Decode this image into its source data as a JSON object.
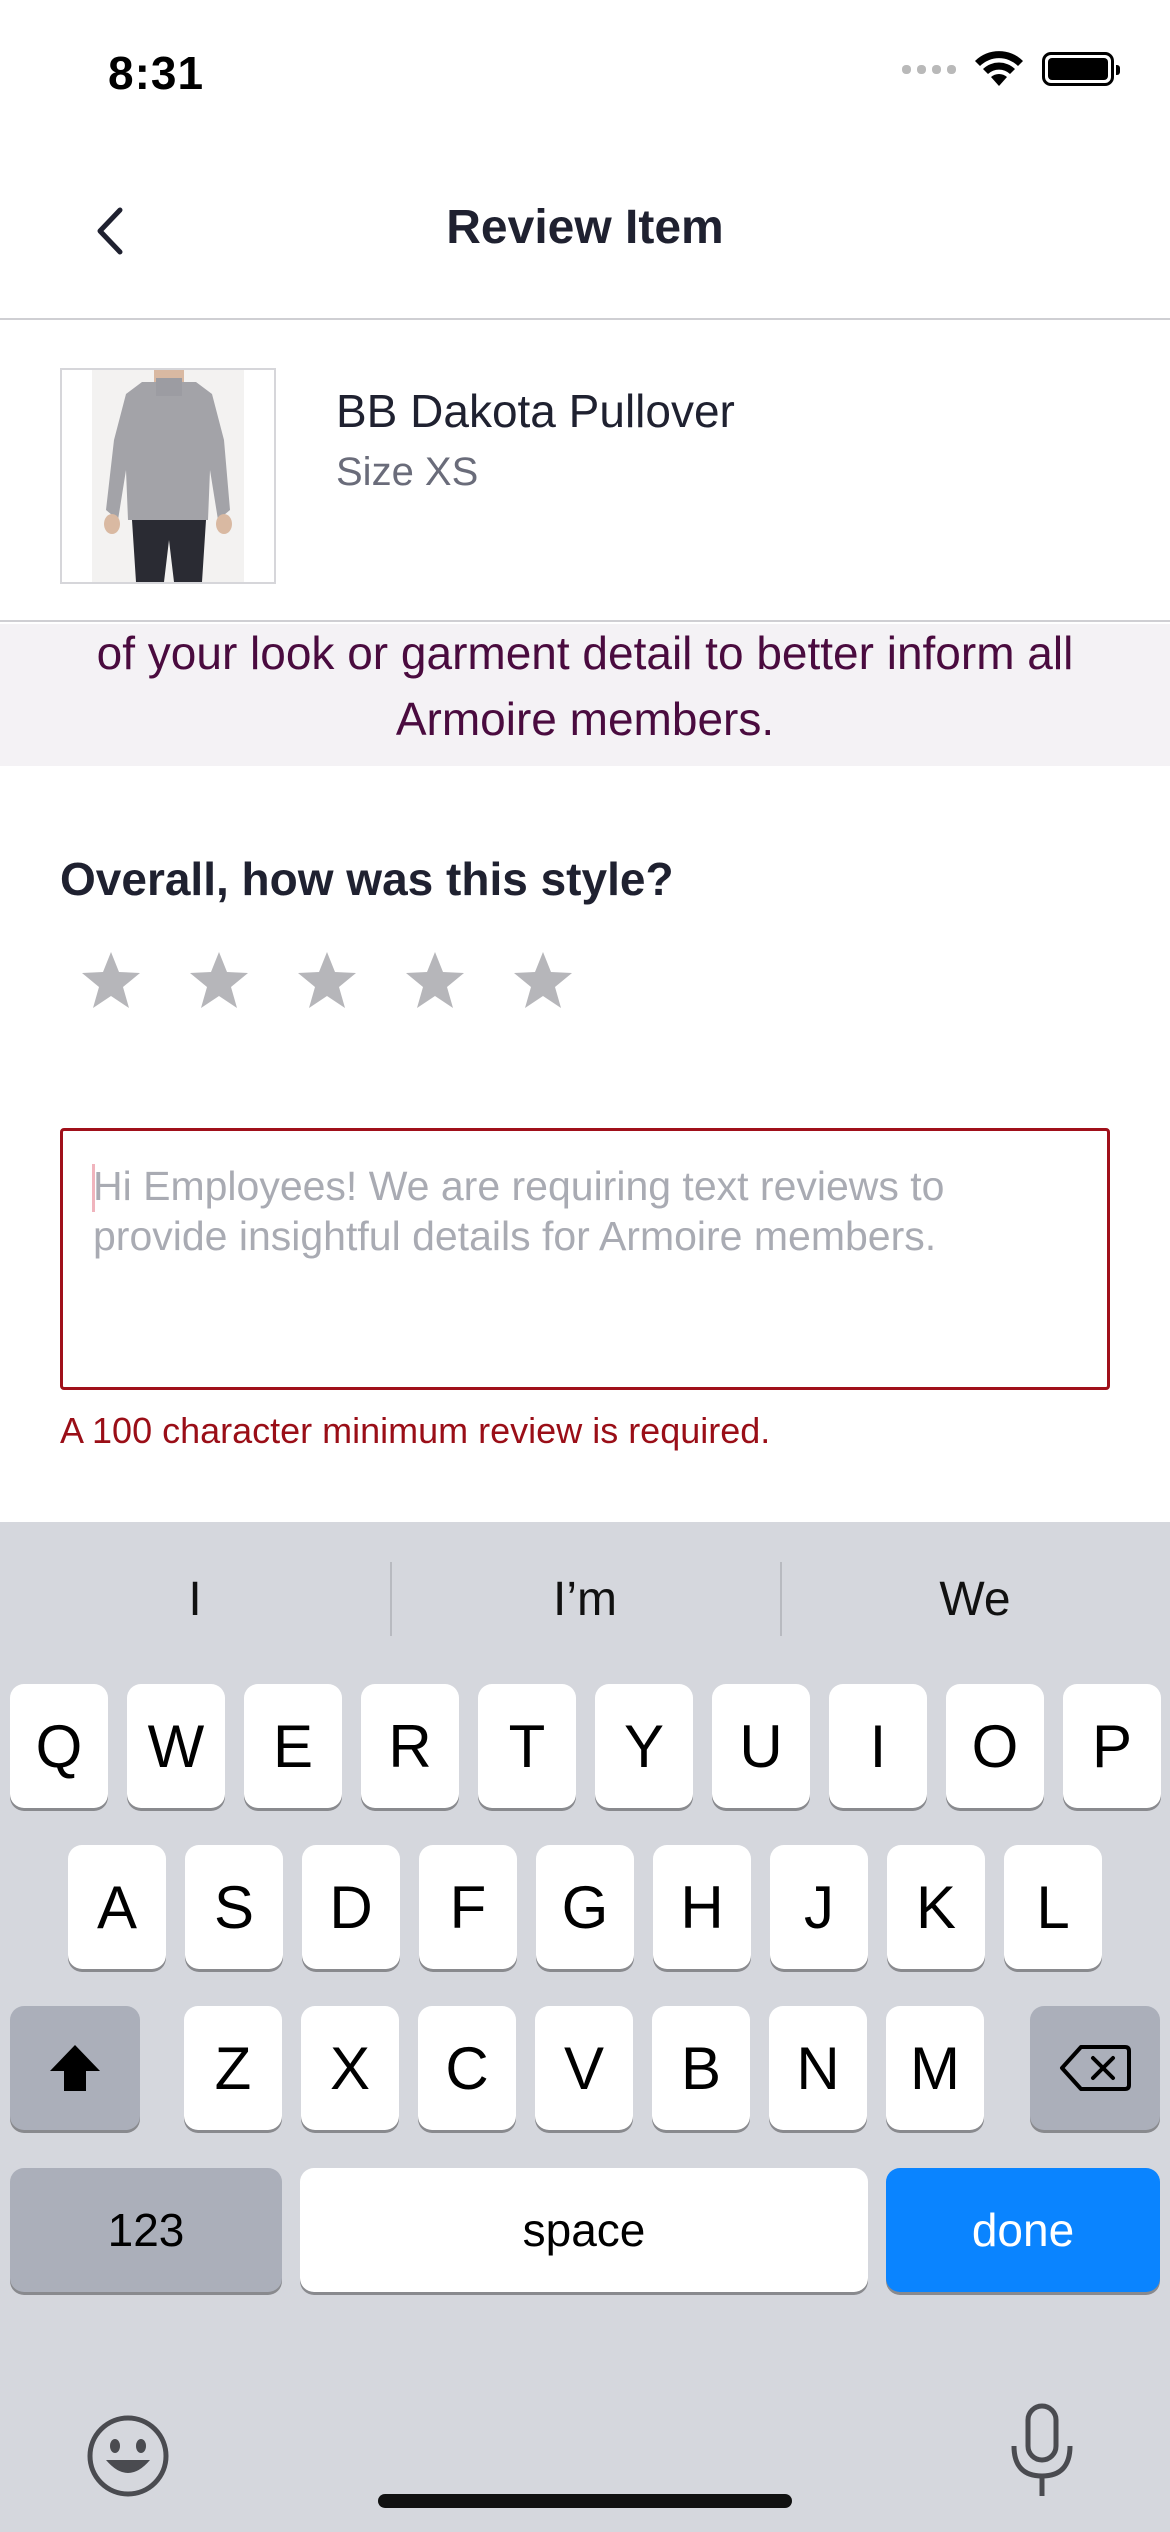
{
  "status_bar": {
    "time": "8:31"
  },
  "nav": {
    "title": "Review Item"
  },
  "product": {
    "name": "BB Dakota Pullover",
    "size": "Size XS"
  },
  "banner": {
    "text": "of your look or garment detail to better inform all Armoire members."
  },
  "rating": {
    "question": "Overall, how was this style?",
    "stars_total": 5,
    "stars_selected": 0,
    "star_color": "#b6b6ba"
  },
  "review": {
    "placeholder": "Hi Employees! We are requiring text reviews to provide insightful details for Armoire members.",
    "error": "A 100 character minimum review is required.",
    "error_color": "#9a0e17"
  },
  "keyboard": {
    "predictions": [
      "I",
      "I’m",
      "We"
    ],
    "row1": [
      "Q",
      "W",
      "E",
      "R",
      "T",
      "Y",
      "U",
      "I",
      "O",
      "P"
    ],
    "row2": [
      "A",
      "S",
      "D",
      "F",
      "G",
      "H",
      "J",
      "K",
      "L"
    ],
    "row3": [
      "Z",
      "X",
      "C",
      "V",
      "B",
      "N",
      "M"
    ],
    "numbers_label": "123",
    "space_label": "space",
    "done_label": "done",
    "done_color": "#0a84ff"
  }
}
